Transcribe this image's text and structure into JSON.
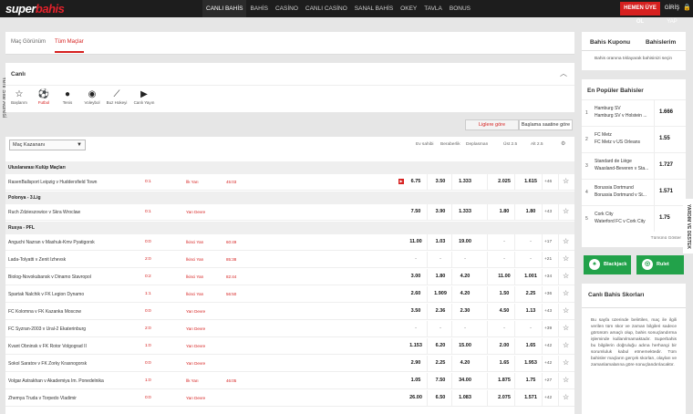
{
  "brand": {
    "logo_a": "super",
    "logo_b": "bahis"
  },
  "nav": [
    {
      "label": "CANLI BAHİS",
      "active": true
    },
    {
      "label": "BAHİS"
    },
    {
      "label": "CASİNO"
    },
    {
      "label": "CANLI CASİNO"
    },
    {
      "label": "SANAL BAHİS"
    },
    {
      "label": "OKEY"
    },
    {
      "label": "TAVLA"
    },
    {
      "label": "BONUS"
    }
  ],
  "header": {
    "register": "HEMEN ÜYE OL",
    "login": "GİRİŞ YAP"
  },
  "side_tab": "Yeni Site Adresi",
  "tabs": {
    "overview": "Maç Görünüm",
    "all": "Tüm Maçlar"
  },
  "live_title": "Canlı",
  "sports": [
    "Başlarım",
    "Futbol",
    "Tenis",
    "Voleybol",
    "Buz Hokeyi",
    "Canlı Yayın"
  ],
  "sort": {
    "league": "Liglere göre",
    "time": "Başlama saatine göre"
  },
  "market_select": "Maç Kazananı",
  "columns": [
    "Ev sahibi",
    "Beraberlik",
    "Deplasman",
    "Üst 2.5",
    "Alt 2.5"
  ],
  "leagues": [
    {
      "name": "Uluslararası Kulüp Maçları",
      "matches": [
        {
          "teams": "RasenBallsport Leipzig v Huddersfield Town",
          "score": "0:1",
          "state": "İlk Yarı",
          "minute": "45:03",
          "tv": true,
          "odds": [
            "6.75",
            "3.50",
            "1.333",
            "2.025",
            "1.615"
          ],
          "extra": "+46"
        }
      ]
    },
    {
      "name": "Polonya - 3.Lig",
      "matches": [
        {
          "teams": "Ruch Zdzieszowice v Skra Wroclaw",
          "score": "0:1",
          "state": "Yarı Devre",
          "minute": "",
          "odds": [
            "7.50",
            "3.90",
            "1.333",
            "1.80",
            "1.80"
          ],
          "extra": "+43"
        }
      ]
    },
    {
      "name": "Rusya - PFL",
      "matches": [
        {
          "teams": "Anguchi Nazran v Mashuk-Kmv Pyatigorsk",
          "score": "0:0",
          "state": "İkinci Yarı",
          "minute": "60:49",
          "odds": [
            "11.00",
            "1.03",
            "19.00",
            "-",
            "-"
          ],
          "extra": "+17"
        },
        {
          "teams": "Lada-Tolyatti v Zenit Izhevsk",
          "score": "2:0",
          "state": "İkinci Yarı",
          "minute": "85:38",
          "odds": [
            "-",
            "-",
            "-",
            "-",
            "-"
          ],
          "extra": "+21"
        },
        {
          "teams": "Biolog-Novokubansk v Dinamo Stavropol",
          "score": "0:2",
          "state": "İkinci Yarı",
          "minute": "82:44",
          "odds": [
            "3.00",
            "1.80",
            "4.20",
            "11.00",
            "1.001"
          ],
          "extra": "+34"
        },
        {
          "teams": "Spartak Nalchik v FK Legion Dynamo",
          "score": "1:1",
          "state": "İkinci Yarı",
          "minute": "56:50",
          "odds": [
            "2.60",
            "1.909",
            "4.20",
            "1.50",
            "2.25"
          ],
          "extra": "+36"
        },
        {
          "teams": "FC Kolomna v FK Kazanka Moscow",
          "score": "0:0",
          "state": "Yarı Devre",
          "minute": "",
          "odds": [
            "3.50",
            "2.36",
            "2.30",
            "4.50",
            "1.13"
          ],
          "extra": "+43"
        },
        {
          "teams": "FC Syzran-2003 v Ural-2 Ekaterinburg",
          "score": "2:0",
          "state": "Yarı Devre",
          "minute": "",
          "odds": [
            "-",
            "-",
            "-",
            "-",
            "-"
          ],
          "extra": "+39"
        },
        {
          "teams": "Kvant Obninsk v FK Rotor Volgograd II",
          "score": "1:0",
          "state": "Yarı Devre",
          "minute": "",
          "odds": [
            "1.153",
            "6.20",
            "15.00",
            "2.00",
            "1.65"
          ],
          "extra": "+42"
        },
        {
          "teams": "Sokol Saratov v FK Zorky Krasnogorsk",
          "score": "0:0",
          "state": "Yarı Devre",
          "minute": "",
          "odds": [
            "2.90",
            "2.25",
            "4.20",
            "1.65",
            "1.953"
          ],
          "extra": "+42"
        },
        {
          "teams": "Volgar Astrakhan v Akademiya Im. Ponedelnika",
          "score": "1:0",
          "state": "İlk Yarı",
          "minute": "46:05",
          "odds": [
            "1.05",
            "7.50",
            "34.00",
            "1.875",
            "1.75"
          ],
          "extra": "+27"
        },
        {
          "teams": "Zhemya Truda v Torpedo Vladimir",
          "score": "0:0",
          "state": "Yarı Devre",
          "minute": "",
          "odds": [
            "26.00",
            "6.50",
            "1.083",
            "2.075",
            "1.571"
          ],
          "extra": "+42"
        }
      ]
    }
  ],
  "coupon": {
    "tab1": "Bahis Kuponu",
    "tab2": "Bahislerim",
    "info": "Bahis oranına tıklayarak bahisinizi seçin"
  },
  "popular": {
    "title": "En Popüler Bahisler",
    "all": "Tümünü Göster",
    "items": [
      {
        "n": "1",
        "l1": "Hamburg SV",
        "l2": "Hamburg SV v Holstein ...",
        "odd": "1.666"
      },
      {
        "n": "2",
        "l1": "FC Metz",
        "l2": "FC Metz v US Orleans",
        "odd": "1.55"
      },
      {
        "n": "3",
        "l1": "Standard de Liège",
        "l2": "Waasland-Beveren v Sta...",
        "odd": "1.727"
      },
      {
        "n": "4",
        "l1": "Borussia Dortmund",
        "l2": "Borussia Dortmund v St...",
        "odd": "1.571"
      },
      {
        "n": "5",
        "l1": "Cork City",
        "l2": "Waterford FC v Cork City",
        "odd": "1.75"
      }
    ]
  },
  "games": {
    "blackjack": "Blackjack",
    "rulet": "Rulet"
  },
  "scores": {
    "title": "Canlı Bahis Skorları",
    "text": "Bu sayfa üzerinde belirtilen, maç ile ilgili verilen tüm skor ve zaman bilgileri sadece görünüm amaçlı olup, bahis sonuçlandırma işleminde kullanılmamaktadır. Superbahis bu bilgilerin doğruluğu adına herhangi bir sorumluluk kabul etmemektedir. Tüm bahisler maçların gerçek skorları, olayları ve zamanlamalarına göre sonuçlandırılacaktır."
  },
  "support": "YARDIM VE DESTEK",
  "colors": {
    "brand_red": "#d6201f",
    "dark_bar": "#1d1d1d",
    "green": "#22a24a"
  },
  "icons": {
    "star": "star-icon",
    "football": "football-icon",
    "tennis": "tennis-icon",
    "volleyball": "volleyball-icon",
    "hockey": "hockey-icon",
    "live": "play-icon",
    "gear": "gear-icon",
    "lock": "lock-icon"
  }
}
